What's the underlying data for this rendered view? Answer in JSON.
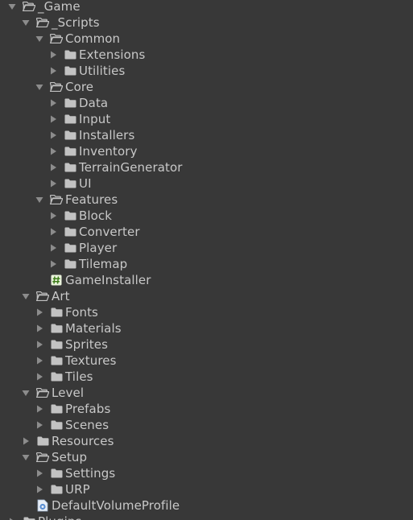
{
  "colors": {
    "background": "#383838",
    "text": "#c8c8c8",
    "folder_icon": "#c2c2c2",
    "arrow": "#8c8c8c",
    "script_icon_bg": "#eaf4dc",
    "script_icon_hash": "#3f7d1c",
    "asset_icon": "#5a8fd4"
  },
  "tree": [
    {
      "label": "_Game",
      "depth": 0,
      "type": "folder",
      "expanded": true
    },
    {
      "label": "_Scripts",
      "depth": 1,
      "type": "folder",
      "expanded": true
    },
    {
      "label": "Common",
      "depth": 2,
      "type": "folder",
      "expanded": true
    },
    {
      "label": "Extensions",
      "depth": 3,
      "type": "folder",
      "expanded": false
    },
    {
      "label": "Utilities",
      "depth": 3,
      "type": "folder",
      "expanded": false
    },
    {
      "label": "Core",
      "depth": 2,
      "type": "folder",
      "expanded": true
    },
    {
      "label": "Data",
      "depth": 3,
      "type": "folder",
      "expanded": false
    },
    {
      "label": "Input",
      "depth": 3,
      "type": "folder",
      "expanded": false
    },
    {
      "label": "Installers",
      "depth": 3,
      "type": "folder",
      "expanded": false
    },
    {
      "label": "Inventory",
      "depth": 3,
      "type": "folder",
      "expanded": false
    },
    {
      "label": "TerrainGenerator",
      "depth": 3,
      "type": "folder",
      "expanded": false
    },
    {
      "label": "UI",
      "depth": 3,
      "type": "folder",
      "expanded": false
    },
    {
      "label": "Features",
      "depth": 2,
      "type": "folder",
      "expanded": true
    },
    {
      "label": "Block",
      "depth": 3,
      "type": "folder",
      "expanded": false
    },
    {
      "label": "Converter",
      "depth": 3,
      "type": "folder",
      "expanded": false
    },
    {
      "label": "Player",
      "depth": 3,
      "type": "folder",
      "expanded": false
    },
    {
      "label": "Tilemap",
      "depth": 3,
      "type": "folder",
      "expanded": false
    },
    {
      "label": "GameInstaller",
      "depth": 2,
      "type": "script"
    },
    {
      "label": "Art",
      "depth": 1,
      "type": "folder",
      "expanded": true
    },
    {
      "label": "Fonts",
      "depth": 2,
      "type": "folder",
      "expanded": false
    },
    {
      "label": "Materials",
      "depth": 2,
      "type": "folder",
      "expanded": false
    },
    {
      "label": "Sprites",
      "depth": 2,
      "type": "folder",
      "expanded": false
    },
    {
      "label": "Textures",
      "depth": 2,
      "type": "folder",
      "expanded": false
    },
    {
      "label": "Tiles",
      "depth": 2,
      "type": "folder",
      "expanded": false
    },
    {
      "label": "Level",
      "depth": 1,
      "type": "folder",
      "expanded": true
    },
    {
      "label": "Prefabs",
      "depth": 2,
      "type": "folder",
      "expanded": false
    },
    {
      "label": "Scenes",
      "depth": 2,
      "type": "folder",
      "expanded": false
    },
    {
      "label": "Resources",
      "depth": 1,
      "type": "folder",
      "expanded": false
    },
    {
      "label": "Setup",
      "depth": 1,
      "type": "folder",
      "expanded": true
    },
    {
      "label": "Settings",
      "depth": 2,
      "type": "folder",
      "expanded": false
    },
    {
      "label": "URP",
      "depth": 2,
      "type": "folder",
      "expanded": false
    },
    {
      "label": "DefaultVolumeProfile",
      "depth": 1,
      "type": "asset"
    },
    {
      "label": "Plugins",
      "depth": 0,
      "type": "folder",
      "expanded": false
    }
  ]
}
